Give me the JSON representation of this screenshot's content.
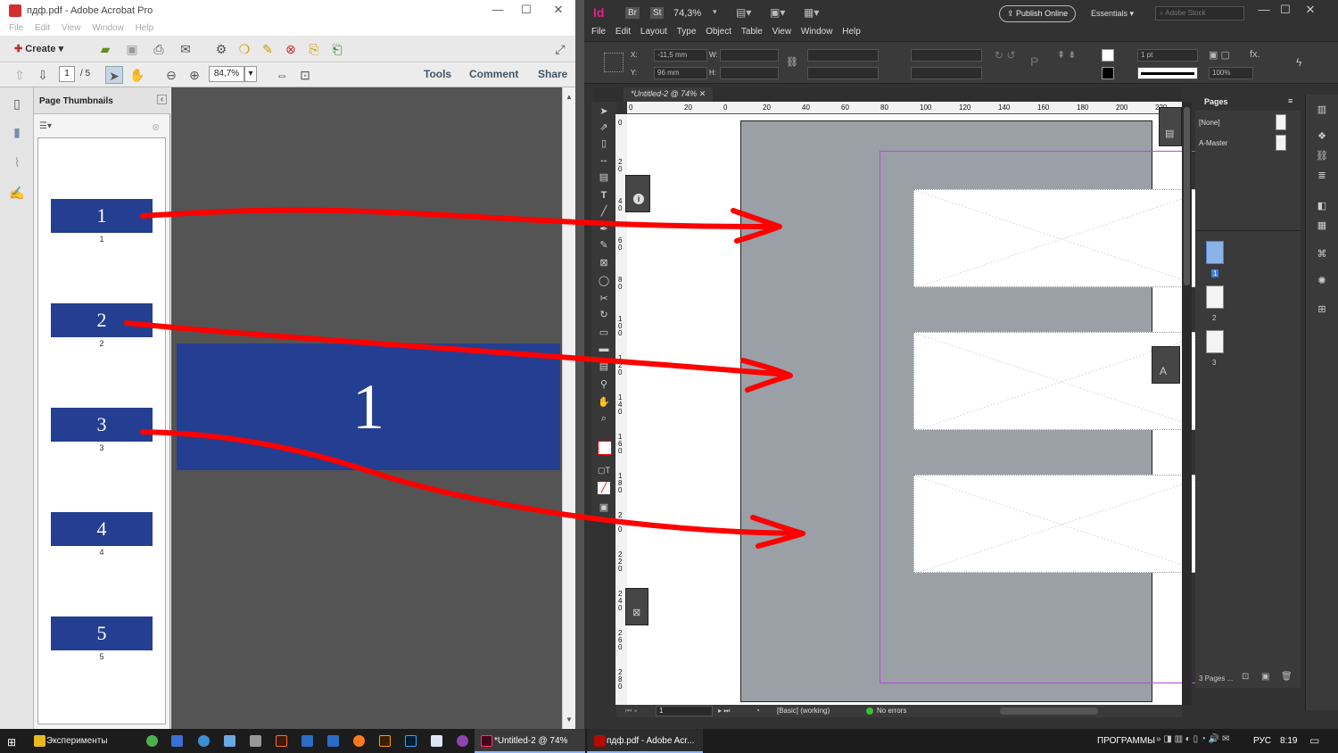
{
  "acrobat": {
    "title": "пдф.pdf - Adobe Acrobat Pro",
    "menu": [
      "File",
      "Edit",
      "View",
      "Window",
      "Help"
    ],
    "create_label": "Create",
    "page_current": "1",
    "page_total": "/ 5",
    "zoom": "84,7%",
    "links": {
      "tools": "Tools",
      "comment": "Comment",
      "share": "Share"
    },
    "panel_title": "Page Thumbnails",
    "thumbnails": [
      {
        "label": "1",
        "caption": "1"
      },
      {
        "label": "2",
        "caption": "2"
      },
      {
        "label": "3",
        "caption": "3"
      },
      {
        "label": "4",
        "caption": "4"
      },
      {
        "label": "5",
        "caption": "5"
      }
    ],
    "document_page_text": "1",
    "colors": {
      "page_blue": "#243f91",
      "doc_bg": "#545454"
    }
  },
  "indesign": {
    "logo": "Id",
    "bridge": "Br",
    "stock": "St",
    "zoom": "74,3%",
    "publish_label": "Publish Online",
    "workspace": "Essentials",
    "search_placeholder": "Adobe Stock",
    "menu": [
      "File",
      "Edit",
      "Layout",
      "Type",
      "Object",
      "Table",
      "View",
      "Window",
      "Help"
    ],
    "x_label": "X:",
    "x_value": "-11,5 mm",
    "y_label": "Y:",
    "y_value": "96 mm",
    "w_label": "W:",
    "h_label": "H:",
    "stroke_weight": "1 pt",
    "opacity": "100%",
    "tab_title": "*Untitled-2 @ 74%",
    "ruler_h": [
      "0",
      "20",
      "0",
      "20",
      "40",
      "60",
      "80",
      "100",
      "120",
      "140",
      "160",
      "180",
      "200",
      "220"
    ],
    "ruler_v": [
      "0",
      "2 0",
      "4 0",
      "6 0",
      "8 0",
      "1 0 0",
      "1 2 0",
      "1 4 0",
      "1 6 0",
      "1 8 0",
      "2 0 0",
      "2 2 0",
      "2 4 0",
      "2 6 0",
      "2 8 0"
    ],
    "pages_panel": {
      "title": "Pages",
      "none": "[None]",
      "master": "A-Master",
      "page_numbers": [
        "1",
        "2",
        "3"
      ],
      "footer": "3 Pages ..."
    },
    "status": {
      "page": "1",
      "preflight": "[Basic] (working)",
      "errors": "No errors"
    },
    "colors": {
      "accent": "#e61f8b",
      "margin": "#b44ad9",
      "page_gray": "#9aa0a6"
    }
  },
  "taskbar": {
    "explorer": "Эксперименты",
    "indd_task": "*Untitled-2 @ 74%",
    "acro_task": "пдф.pdf - Adobe Acr...",
    "programs": "ПРОГРАММЫ",
    "lang": "РУС",
    "time": "8:19"
  },
  "annotation": {
    "arrow_color": "#ff0000"
  }
}
